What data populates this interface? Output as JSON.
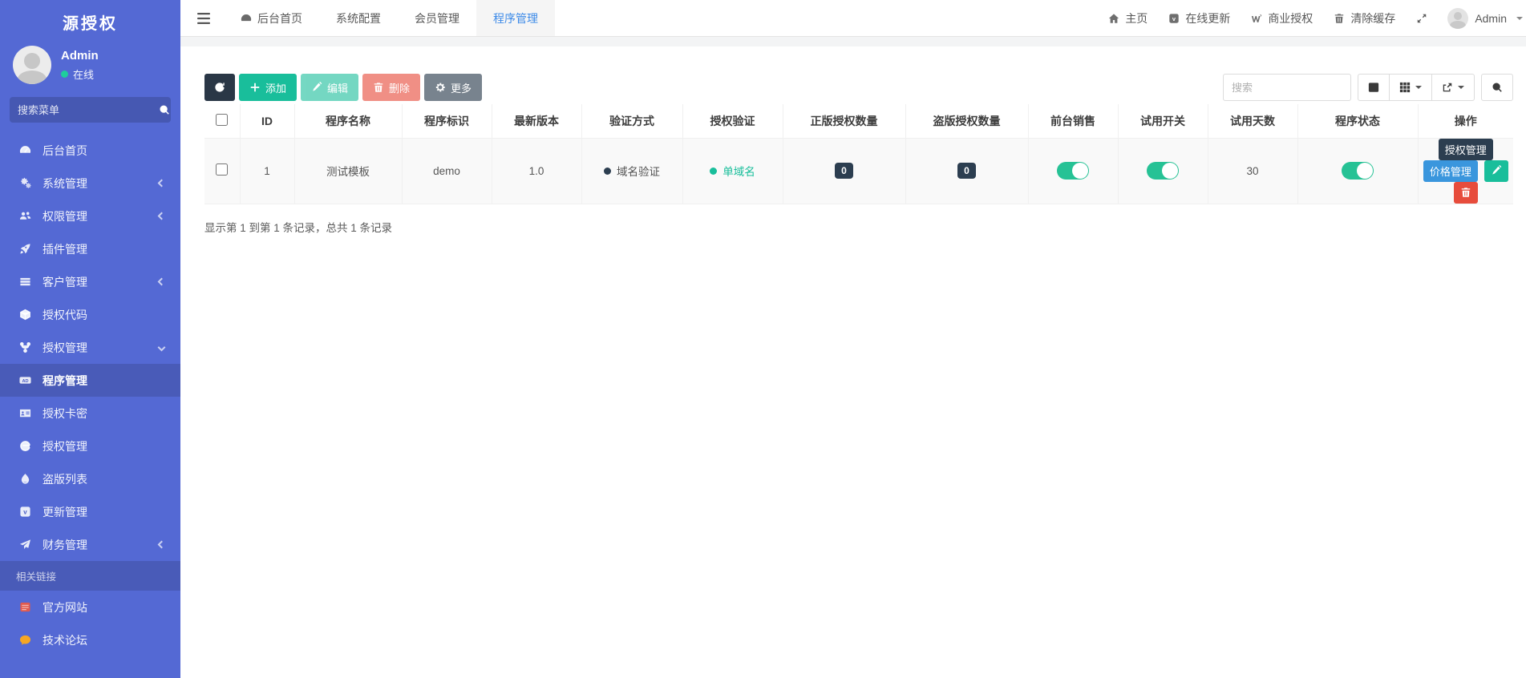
{
  "app": {
    "brand": "源授权"
  },
  "sidebar": {
    "user": {
      "name": "Admin",
      "status": "在线"
    },
    "menu_search_placeholder": "搜索菜单",
    "items": [
      {
        "icon": "dashboard-icon",
        "label": "后台首页"
      },
      {
        "icon": "gears-icon",
        "label": "系统管理"
      },
      {
        "icon": "users-icon",
        "label": "权限管理"
      },
      {
        "icon": "rocket-icon",
        "label": "插件管理"
      },
      {
        "icon": "table-icon",
        "label": "客户管理"
      },
      {
        "icon": "code-icon",
        "label": "授权代码"
      },
      {
        "icon": "fork-icon",
        "label": "授权管理"
      },
      {
        "icon": "ad-icon",
        "label": "程序管理"
      },
      {
        "icon": "id-card-icon",
        "label": "授权卡密"
      },
      {
        "icon": "browser-icon",
        "label": "授权管理"
      },
      {
        "icon": "droplet-icon",
        "label": "盗版列表"
      },
      {
        "icon": "vimeo-icon",
        "label": "更新管理"
      },
      {
        "icon": "paper-plane-icon",
        "label": "财务管理"
      }
    ],
    "links_header": "相关链接",
    "links": [
      {
        "icon": "website-icon",
        "label": "官方网站"
      },
      {
        "icon": "forum-icon",
        "label": "技术论坛"
      }
    ]
  },
  "topnav": {
    "tabs": [
      {
        "label": "后台首页"
      },
      {
        "label": "系统配置"
      },
      {
        "label": "会员管理"
      },
      {
        "label": "程序管理"
      }
    ],
    "actions": [
      {
        "label": "主页"
      },
      {
        "label": "在线更新"
      },
      {
        "label": "商业授权"
      },
      {
        "label": "清除缓存"
      }
    ],
    "user": "Admin"
  },
  "toolbar": {
    "add": "添加",
    "edit": "编辑",
    "delete": "删除",
    "more": "更多",
    "search_placeholder": "搜索"
  },
  "table": {
    "columns": {
      "id": "ID",
      "name": "程序名称",
      "identifier": "程序标识",
      "version": "最新版本",
      "verify_method": "验证方式",
      "auth_verify": "授权验证",
      "genuine_count": "正版授权数量",
      "pirated_count": "盗版授权数量",
      "front_sale": "前台销售",
      "trial_switch": "试用开关",
      "trial_days": "试用天数",
      "status": "程序状态",
      "operations": "操作"
    },
    "row": {
      "id": "1",
      "name": "测试模板",
      "identifier": "demo",
      "version": "1.0",
      "verify_method": "域名验证",
      "auth_verify": "单域名",
      "genuine_count": "0",
      "pirated_count": "0",
      "front_sale_on": "on",
      "trial_on": "on",
      "trial_days": "30",
      "status_on": "on",
      "actions": {
        "auth": "授权管理",
        "price": "价格管理"
      }
    }
  },
  "pagination": {
    "summary": "显示第 1 到第 1 条记录，总共 1 条记录"
  },
  "colors": {
    "sidebar_blue": "#5469d4",
    "accent_green": "#19be9b",
    "accent_blue": "#3a96dd",
    "navy": "#2c3e50",
    "danger": "#e74c3c"
  }
}
